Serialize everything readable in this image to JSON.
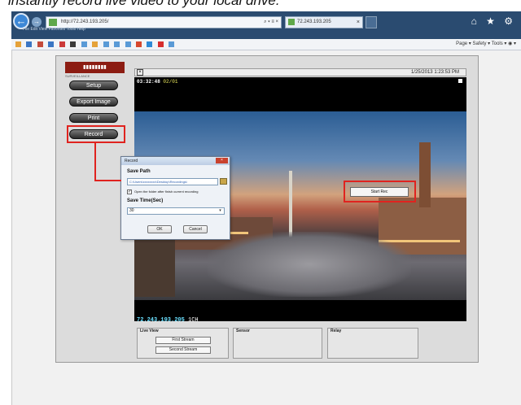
{
  "caption": "instantly record live video to your local drive.",
  "browser": {
    "address": "http://72.243.193.205/",
    "address_actions": "⌕ ▾ ≡ ×",
    "tab_title": "72.243.193.205",
    "tab_close": "×",
    "menu": "File  Edit  View  Favorites  Tools  Help",
    "right_icons": "⌂ ★ ⚙",
    "command_bar": "Page ▾   Safety ▾   Tools ▾   ◉ ▾",
    "back_glyph": "←",
    "fwd_glyph": "→"
  },
  "sidebar": {
    "buttons": [
      "Setup",
      "Export Image",
      "Print",
      "Record"
    ],
    "logo_sub": "SURVEILLANCE"
  },
  "video": {
    "close": "×",
    "datetime": "1/25/2013  1:23:53 PM",
    "osd_time": "03:32:48",
    "osd_date": "02/01",
    "osd_ip": "72.243.193.205",
    "osd_ch": "1CH"
  },
  "context_menu": {
    "item": "Start Rec"
  },
  "panels": {
    "live_view": {
      "title": "Live View",
      "first": "First Stream",
      "second": "Second Stream"
    },
    "sensor": "Sensor",
    "relay": "Relay"
  },
  "dialog": {
    "title": "Record",
    "close": "×",
    "save_path_label": "Save Path",
    "save_path_value": "C:\\Users\\xxxxxxxx\\Desktop\\Recordings\\",
    "open_folder_label": "Open the folder after finish current recording",
    "check_mark": "✓",
    "save_time_label": "Save Time(Sec)",
    "save_time_value": "30",
    "select_arrow": "▾",
    "ok": "OK",
    "cancel": "Cancel"
  },
  "colors": {
    "highlight": "#e0231f",
    "chrome": "#2a4b70",
    "logo": "#8c1c12"
  }
}
